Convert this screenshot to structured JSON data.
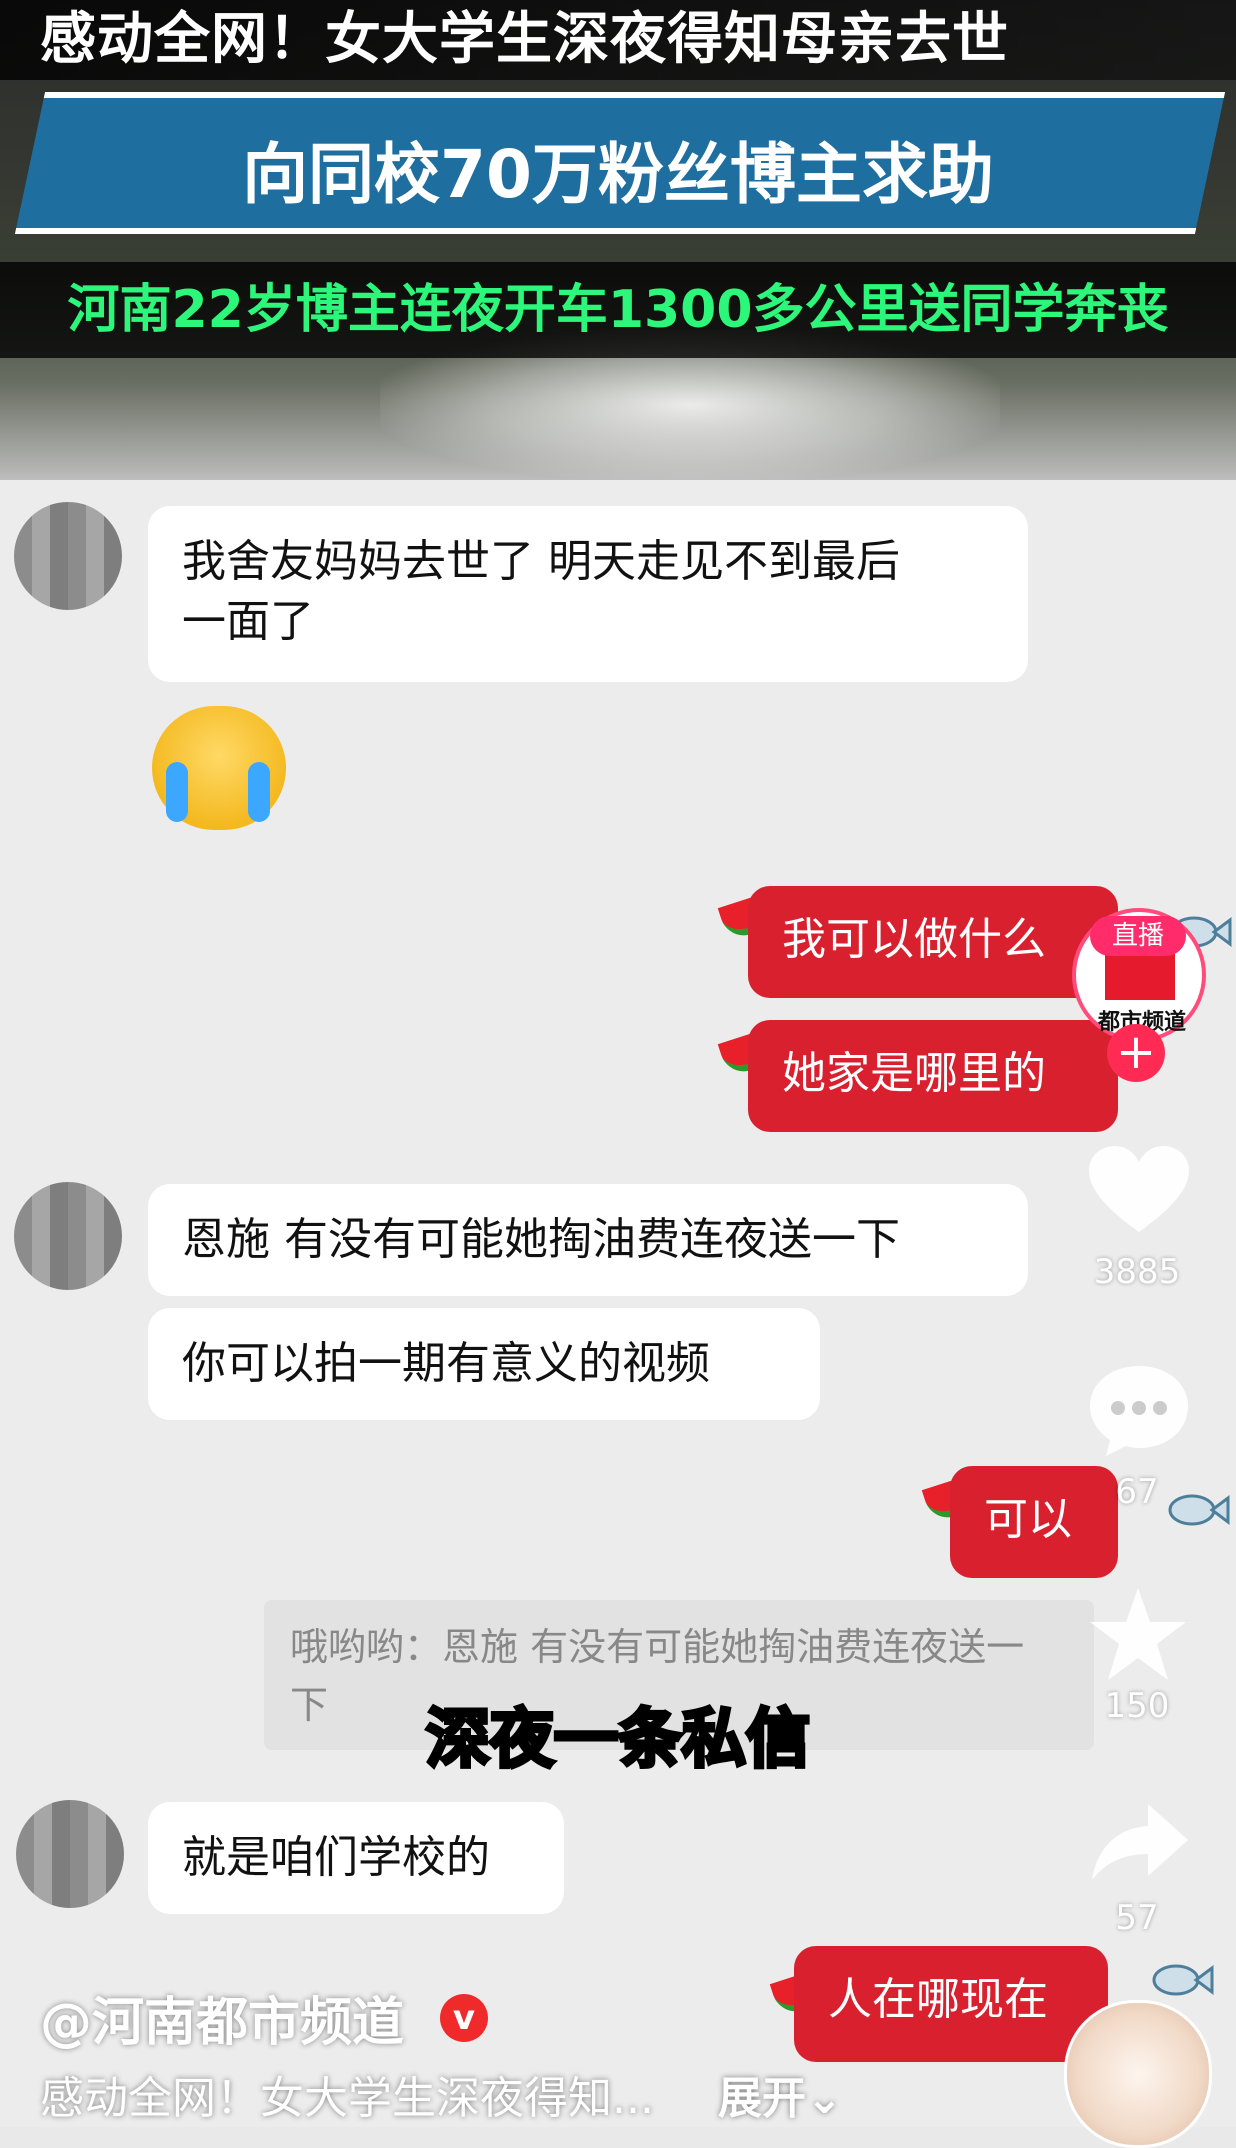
{
  "banner": {
    "headline1": "感动全网！女大学生深夜得知母亲去世",
    "headline2": "向同校70万粉丝博主求助",
    "headline3": "河南22岁博主连夜开车1300多公里送同学奔丧"
  },
  "chat": {
    "messages_left_1": [
      "我舍友妈妈去世了 明天走见不到最后",
      "一面了"
    ],
    "messages_right_1": [
      "我可以做什么",
      "她家是哪里的"
    ],
    "messages_left_2": [
      "恩施 有没有可能她掏油费连夜送一下",
      "你可以拍一期有意义的视频"
    ],
    "message_right_2": "可以",
    "quote": [
      "哦哟哟：恩施 有没有可能她掏油费连夜送一",
      "下"
    ],
    "message_left_3": "就是咱们学校的",
    "message_right_3": "人在哪现在"
  },
  "caption": "深夜一条私信",
  "rail": {
    "live_badge": "直播",
    "channel_logo_text": "都市频道",
    "follow_plus": "+",
    "likes": "3885",
    "comments": "67",
    "favorites": "150",
    "shares": "57"
  },
  "meta": {
    "author": "@河南都市频道",
    "verified_mark": "v",
    "description": "感动全网！女大学生深夜得知...",
    "expand": "展开⌄"
  },
  "colors": {
    "outgoing_bubble": "#d9202f",
    "headline_band": "#1f6ea0",
    "headline3_text": "#2cf77a"
  }
}
